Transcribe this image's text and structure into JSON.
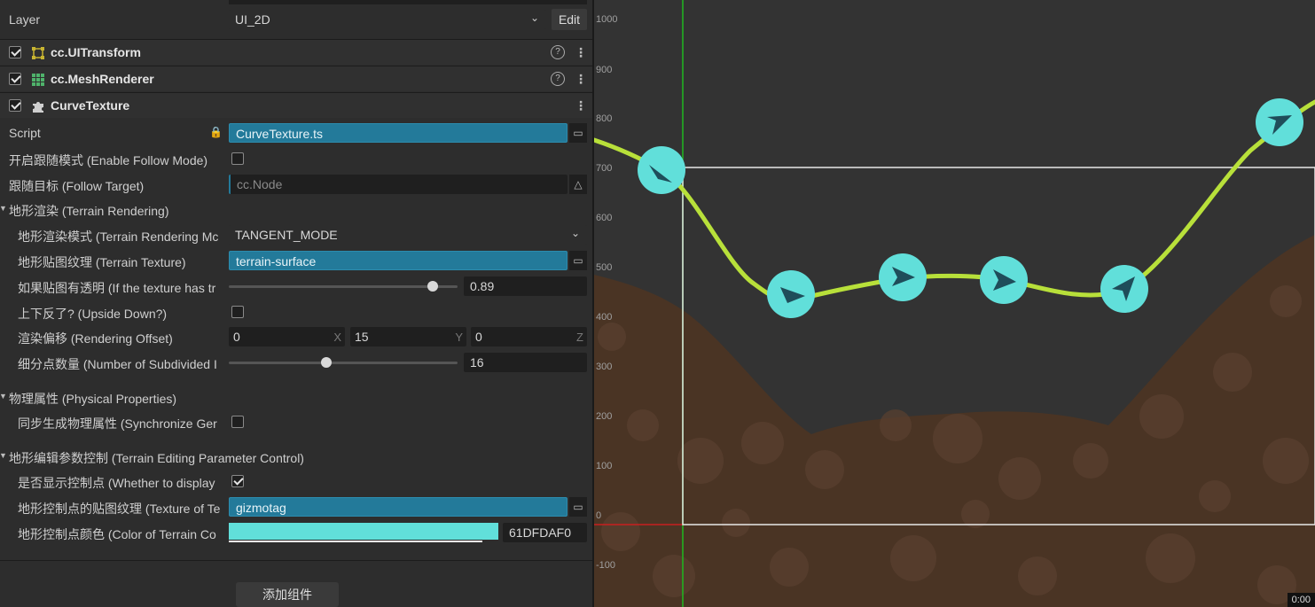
{
  "layer": {
    "label": "Layer",
    "value": "UI_2D",
    "edit": "Edit"
  },
  "components": {
    "transform": "cc.UITransform",
    "meshrenderer": "cc.MeshRenderer",
    "curve": "CurveTexture"
  },
  "props": {
    "script_label": "Script",
    "script_value": "CurveTexture.ts",
    "follow_mode": "开启跟随模式 (Enable Follow Mode)",
    "follow_target": "跟随目标 (Follow Target)",
    "follow_target_value": "cc.Node",
    "terrain_rendering": "地形渲染 (Terrain Rendering)",
    "render_mode": "地形渲染模式 (Terrain Rendering Mc",
    "render_mode_value": "TANGENT_MODE",
    "terrain_texture": "地形贴图纹理 (Terrain Texture)",
    "terrain_texture_value": "terrain-surface",
    "transparent": "如果贴图有透明 (If the texture has tr",
    "transparent_value": "0.89",
    "upside_down": "上下反了? (Upside Down?)",
    "render_offset": "渲染偏移 (Rendering Offset)",
    "offset_x": "0",
    "offset_y": "15",
    "offset_z": "0",
    "subdivided": "细分点数量 (Number of Subdivided I",
    "subdivided_value": "16",
    "physical": "物理属性 (Physical Properties)",
    "sync_physics": "同步生成物理属性 (Synchronize Ger",
    "editing": "地形编辑参数控制 (Terrain Editing Parameter Control)",
    "show_ctrl": "是否显示控制点 (Whether to display",
    "ctrl_texture": "地形控制点的贴图纹理 (Texture of Te",
    "ctrl_texture_value": "gizmotag",
    "ctrl_color": "地形控制点颜色 (Color of Terrain Co",
    "ctrl_color_value": "61DFDAF0"
  },
  "axes": {
    "x": "X",
    "y": "Y",
    "z": "Z"
  },
  "add_component": "添加组件",
  "colors": {
    "control_point": "#61DFDA",
    "curve": "#b8e03a",
    "ground": "#4a3424"
  },
  "scene": {
    "y_ticks": [
      "1000",
      "900",
      "800",
      "700",
      "600",
      "500",
      "400",
      "300",
      "200",
      "100",
      "0",
      "-100"
    ],
    "badge": "0:00"
  }
}
